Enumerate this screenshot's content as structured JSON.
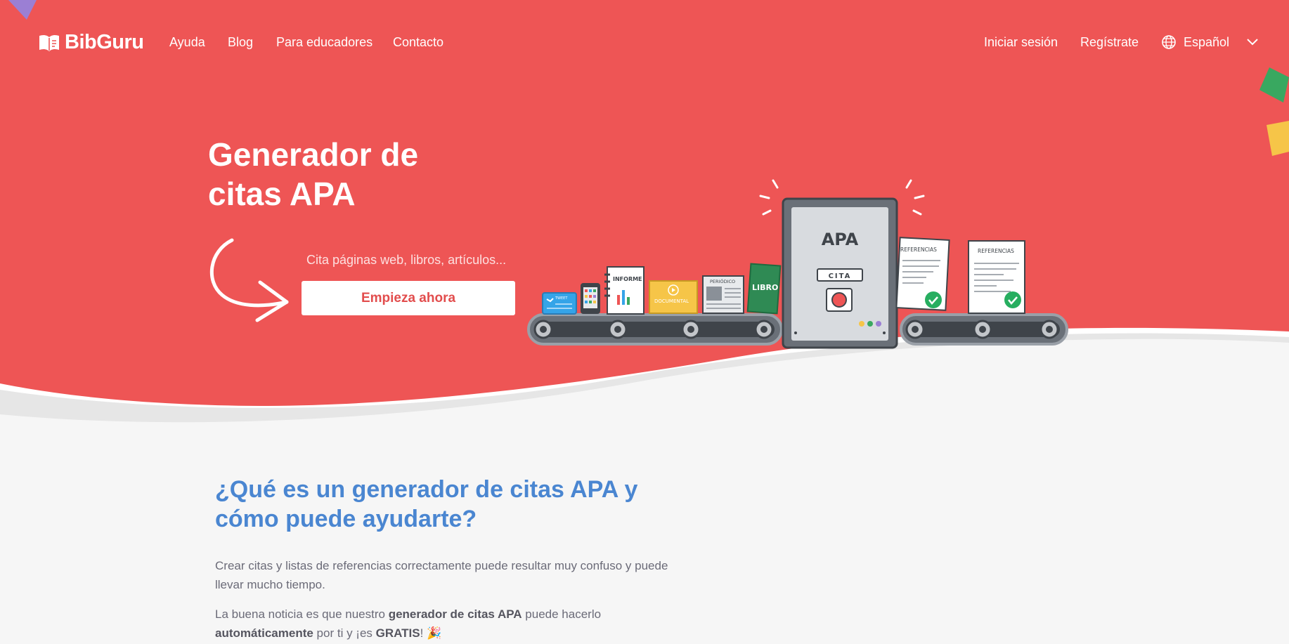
{
  "nav": {
    "logo_text": "BibGuru",
    "links": [
      "Ayuda",
      "Blog",
      "Para educadores",
      "Contacto"
    ],
    "login": "Iniciar sesión",
    "register": "Regístrate",
    "language": "Español"
  },
  "hero": {
    "title_line1": "Generador de",
    "title_line2": "citas APA",
    "subtitle": "Cita páginas web, libros, artículos...",
    "cta": "Empieza ahora"
  },
  "illustration": {
    "machine_label": "APA",
    "machine_button": "CITA",
    "tweet": "TWEET",
    "report": "INFORME",
    "document": "DOCUMENTAL",
    "newspaper": "PERIÓDICO",
    "book": "LIBRO",
    "references": "REFERENCIAS"
  },
  "content": {
    "heading": "¿Qué es un generador de citas APA y cómo puede ayudarte?",
    "p1": "Crear citas y listas de referencias correctamente puede resultar muy confuso y puede llevar mucho tiempo.",
    "p2_a": "La buena noticia es que nuestro ",
    "p2_b": "generador de citas APA",
    "p2_c": " puede hacerlo ",
    "p2_d": "automáticamente",
    "p2_e": " por ti y ¡es ",
    "p2_f": "GRATIS",
    "p2_g": "! 🎉"
  },
  "colors": {
    "hero_red": "#ee5555",
    "heading_blue": "#4a86d1",
    "body_gray": "#6b6b78",
    "background": "#f6f6f6"
  }
}
